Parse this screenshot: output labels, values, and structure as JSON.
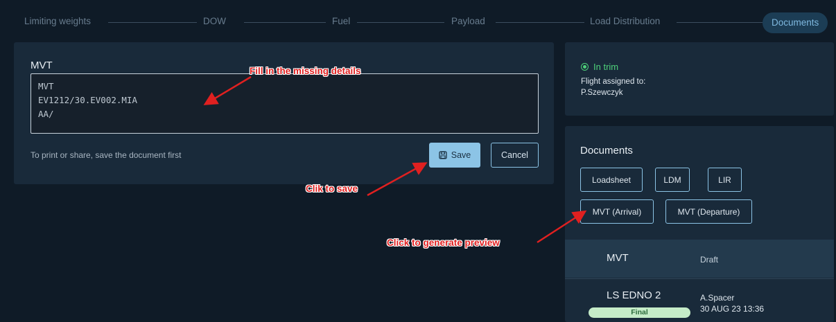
{
  "steps": [
    {
      "label": "Limiting weights",
      "active": false
    },
    {
      "label": "DOW",
      "active": false
    },
    {
      "label": "Fuel",
      "active": false
    },
    {
      "label": "Payload",
      "active": false
    },
    {
      "label": "Load Distribution",
      "active": false
    },
    {
      "label": "Documents",
      "active": true
    }
  ],
  "mvt_editor": {
    "title": "MVT",
    "lines": [
      "MVT",
      "EV1212/30.EV002.MIA",
      "AA/"
    ],
    "hint": "To print or share, save the document first",
    "save_label": "Save",
    "cancel_label": "Cancel",
    "save_icon": "floppy-disk-icon"
  },
  "status": {
    "trim_label": "In trim",
    "assigned_label": "Flight assigned to:",
    "assigned_name": "P.Szewczyk",
    "trim_color": "#4ed17a"
  },
  "documents": {
    "title": "Documents",
    "buttons": [
      "Loadsheet",
      "LDM",
      "LIR",
      "MVT (Arrival)",
      "MVT (Departure)"
    ],
    "list_header": {
      "name": "MVT",
      "status": "Draft"
    },
    "rows": [
      {
        "name": "LS  EDNO 2",
        "badge": "Final",
        "user": "A.Spacer",
        "date": "30 AUG 23 13:36"
      }
    ]
  },
  "annotations": {
    "fill": "Fill in the missing details",
    "save": "Clik to save",
    "preview": "Click to generate preview"
  },
  "colors": {
    "background": "#0f1b27",
    "panel": "#192a3a",
    "accent": "#8cc4e6",
    "annotation": "#e02020",
    "final_badge": "#c5ecc8"
  }
}
